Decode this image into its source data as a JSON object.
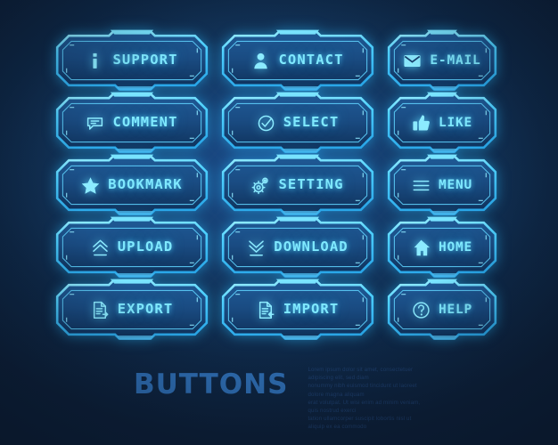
{
  "theme": {
    "accent": "#7fe9ff",
    "frame": "#4fd2ff",
    "face_top": "#1b4f86",
    "face_bottom": "#10365f",
    "background_deep": "#0c1c33",
    "background_center": "#1d4f8f",
    "title_color": "#2f6fb5",
    "body_color": "#1e3f6d"
  },
  "buttons": [
    {
      "id": "support",
      "label": "SUPPORT",
      "icon": "info-icon",
      "size": "wide"
    },
    {
      "id": "contact",
      "label": "CONTACT",
      "icon": "user-icon",
      "size": "wide"
    },
    {
      "id": "email",
      "label": "E-MAIL",
      "icon": "envelope-icon",
      "size": "narrow"
    },
    {
      "id": "comment",
      "label": "COMMENT",
      "icon": "speech-bubble-icon",
      "size": "wide"
    },
    {
      "id": "select",
      "label": "SELECT",
      "icon": "check-circle-icon",
      "size": "wide"
    },
    {
      "id": "like",
      "label": "LIKE",
      "icon": "thumbs-up-icon",
      "size": "narrow"
    },
    {
      "id": "bookmark",
      "label": "BOOKMARK",
      "icon": "star-icon",
      "size": "wide"
    },
    {
      "id": "setting",
      "label": "SETTING",
      "icon": "gears-icon",
      "size": "wide"
    },
    {
      "id": "menu",
      "label": "MENU",
      "icon": "hamburger-icon",
      "size": "narrow"
    },
    {
      "id": "upload",
      "label": "UPLOAD",
      "icon": "chevrons-up-icon",
      "size": "wide"
    },
    {
      "id": "download",
      "label": "DOWNLOAD",
      "icon": "chevrons-down-icon",
      "size": "wide"
    },
    {
      "id": "home",
      "label": "HOME",
      "icon": "house-icon",
      "size": "narrow"
    },
    {
      "id": "export",
      "label": "EXPORT",
      "icon": "file-out-icon",
      "size": "wide"
    },
    {
      "id": "import",
      "label": "IMPORT",
      "icon": "file-in-icon",
      "size": "wide"
    },
    {
      "id": "help",
      "label": "HELP",
      "icon": "question-circle-icon",
      "size": "narrow"
    }
  ],
  "footer": {
    "title": "BUTTONS",
    "lines": [
      "Lorem ipsum dolor sit amet, consectetuer adipiscing elit, sed diam",
      "nonummy nibh euismod tincidunt ut laoreet dolore magna aliquam",
      "erat volutpat. Ut wisi enim ad minim veniam, quis nostrud exerci",
      "tation ullamcorper suscipit lobortis nisl ut aliquip ex ea commodo"
    ]
  }
}
